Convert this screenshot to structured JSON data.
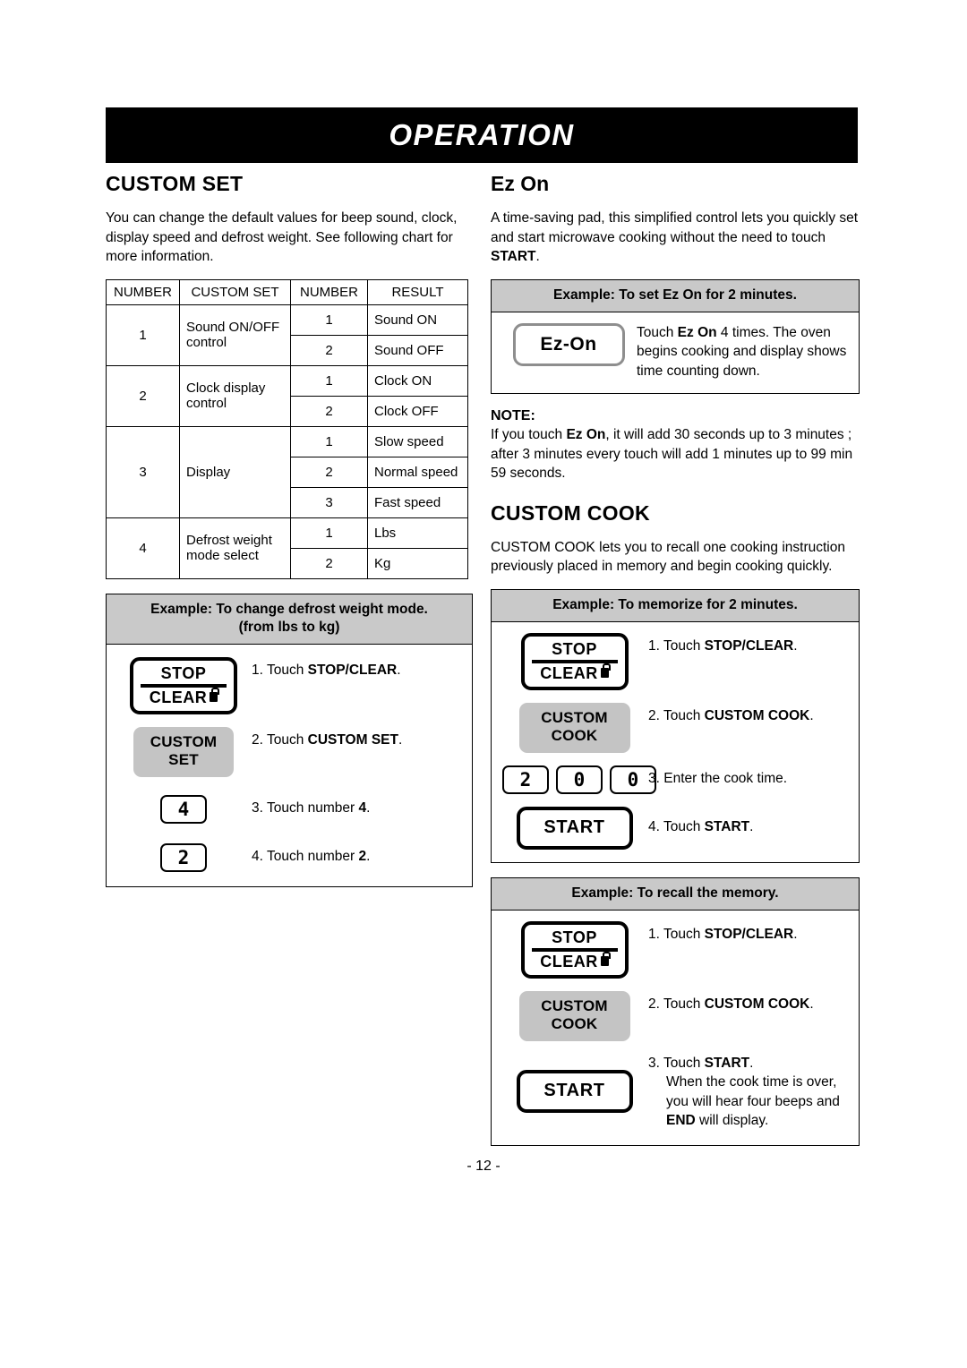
{
  "header": {
    "title": "OPERATION"
  },
  "left": {
    "heading": "CUSTOM SET",
    "intro": "You can change the default values for beep sound, clock, display speed and defrost weight. See following chart for more information.",
    "table": {
      "headers": [
        "NUMBER",
        "CUSTOM SET",
        "NUMBER",
        "RESULT"
      ],
      "groups": [
        {
          "number": "1",
          "custom_set": "Sound ON/OFF control",
          "options": [
            {
              "number": "1",
              "result": "Sound ON"
            },
            {
              "number": "2",
              "result": "Sound OFF"
            }
          ]
        },
        {
          "number": "2",
          "custom_set": "Clock display control",
          "options": [
            {
              "number": "1",
              "result": "Clock ON"
            },
            {
              "number": "2",
              "result": "Clock OFF"
            }
          ]
        },
        {
          "number": "3",
          "custom_set": "Display",
          "options": [
            {
              "number": "1",
              "result": "Slow speed"
            },
            {
              "number": "2",
              "result": "Normal speed"
            },
            {
              "number": "3",
              "result": "Fast speed"
            }
          ]
        },
        {
          "number": "4",
          "custom_set": "Defrost weight mode select",
          "options": [
            {
              "number": "1",
              "result": "Lbs"
            },
            {
              "number": "2",
              "result": "Kg"
            }
          ]
        }
      ]
    },
    "example": {
      "title_line1": "Example: To change defrost weight mode.",
      "title_line2": "(from lbs to kg)",
      "steps": [
        {
          "key": "stop-clear",
          "key_top": "STOP",
          "key_bottom": "CLEAR",
          "text_plain": "1. Touch ",
          "text_bold": "STOP/CLEAR",
          "text_tail": "."
        },
        {
          "key": "custom-set",
          "key_line1": "CUSTOM",
          "key_line2": "SET",
          "text_plain": "2. Touch ",
          "text_bold": "CUSTOM SET",
          "text_tail": "."
        },
        {
          "key": "number",
          "key_label": "4",
          "text_plain": "3. Touch number ",
          "text_bold": "4",
          "text_tail": "."
        },
        {
          "key": "number",
          "key_label": "2",
          "text_plain": "4. Touch number ",
          "text_bold": "2",
          "text_tail": "."
        }
      ]
    }
  },
  "right": {
    "ezon": {
      "heading": "Ez On",
      "intro_pre": "A time-saving pad, this simplified control lets you quickly set and start microwave cooking without the need to touch ",
      "intro_bold": "START",
      "intro_post": ".",
      "example": {
        "title": "Example: To set Ez On for 2 minutes.",
        "key_label": "Ez-On",
        "text_pre": "Touch ",
        "text_bold": "Ez On",
        "text_post": " 4 times. The oven begins cooking and display shows time counting down."
      },
      "note": {
        "label": "NOTE:",
        "pre": "If you touch ",
        "bold": "Ez On",
        "post": ", it will add 30 seconds up to 3 minutes ; after 3 minutes every touch will add 1 minutes up to 99 min 59 seconds."
      }
    },
    "customcook": {
      "heading": "CUSTOM COOK",
      "intro": "CUSTOM COOK lets you to recall one cooking instruction previously placed in memory and begin cooking quickly.",
      "example_memorize": {
        "title": "Example: To memorize for 2 minutes.",
        "steps": [
          {
            "key": "stop-clear",
            "key_top": "STOP",
            "key_bottom": "CLEAR",
            "text_plain": "1. Touch ",
            "text_bold": "STOP/CLEAR",
            "text_tail": "."
          },
          {
            "key": "custom-cook",
            "key_line1": "CUSTOM",
            "key_line2": "COOK",
            "text_plain": "2. Touch ",
            "text_bold": "CUSTOM COOK",
            "text_tail": "."
          },
          {
            "key": "number-group",
            "key_labels": [
              "2",
              "0",
              "0"
            ],
            "text_plain": "3. Enter the cook time.",
            "text_bold": "",
            "text_tail": ""
          },
          {
            "key": "start",
            "key_label": "START",
            "text_plain": "4. Touch ",
            "text_bold": "START",
            "text_tail": "."
          }
        ]
      },
      "example_recall": {
        "title": "Example: To recall the memory.",
        "steps": [
          {
            "key": "stop-clear",
            "key_top": "STOP",
            "key_bottom": "CLEAR",
            "text_plain": "1. Touch ",
            "text_bold": "STOP/CLEAR",
            "text_tail": "."
          },
          {
            "key": "custom-cook",
            "key_line1": "CUSTOM",
            "key_line2": "COOK",
            "text_plain": "2. Touch ",
            "text_bold": "CUSTOM COOK",
            "text_tail": "."
          }
        ],
        "final_step": {
          "key": "start",
          "key_label": "START",
          "line1_plain": "3. Touch ",
          "line1_bold": "START",
          "line1_tail": ".",
          "line2": "When the cook time is over,",
          "line3": "you will hear four beeps and",
          "line4_bold": "END",
          "line4_tail": " will display."
        }
      }
    }
  },
  "footer": {
    "page_number": "- 12 -"
  },
  "colors": {
    "header_bg": "#000000",
    "example_head_bg": "#c9c9c9",
    "gray_key_bg": "#c4c4c4",
    "ezon_border": "#8e8e8e"
  }
}
